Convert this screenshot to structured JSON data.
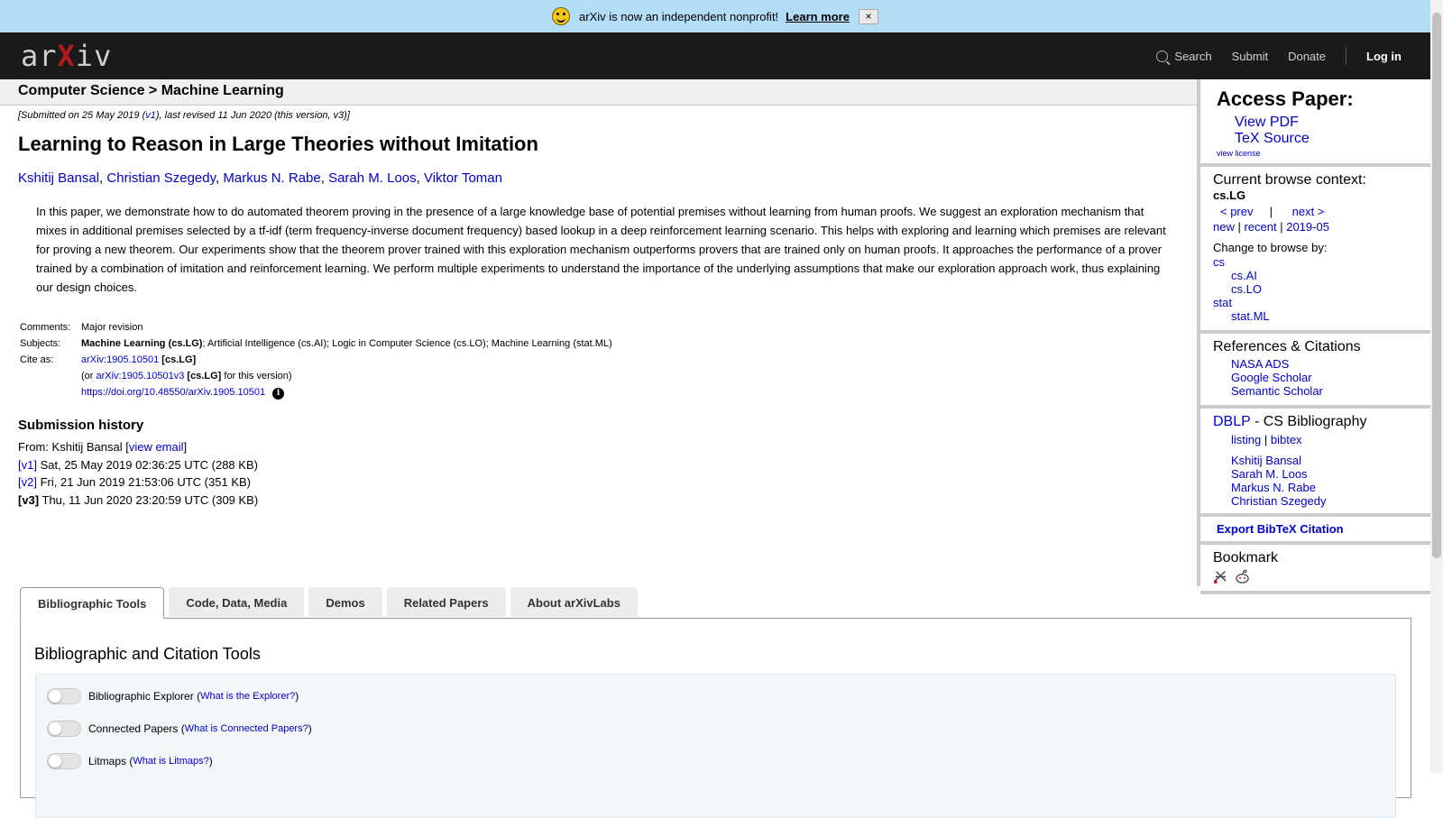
{
  "banner": {
    "text": "arXiv is now an independent nonprofit!",
    "link": "Learn more",
    "close": "×"
  },
  "nav": {
    "logo_a": "ar",
    "logo_x": "X",
    "logo_b": "iv",
    "search": "Search",
    "submit": "Submit",
    "donate": "Donate",
    "login": "Log in"
  },
  "breadcrumb": "Computer Science > Machine Learning",
  "paper": {
    "dateline_pre": "[Submitted on 25 May 2019 (",
    "dateline_v1": "v1",
    "dateline_post": "), last revised 11 Jun 2020 (this version, v3)]",
    "title": "Learning to Reason in Large Theories without Imitation",
    "authors": [
      "Kshitij Bansal",
      "Christian Szegedy",
      "Markus N. Rabe",
      "Sarah M. Loos",
      "Viktor Toman"
    ],
    "abstract": "In this paper, we demonstrate how to do automated theorem proving in the presence of a large knowledge base of potential premises without learning from human proofs. We suggest an exploration mechanism that mixes in additional premises selected by a tf-idf (term frequency-inverse document frequency) based lookup in a deep reinforcement learning scenario. This helps with exploring and learning which premises are relevant for proving a new theorem. Our experiments show that the theorem prover trained with this exploration mechanism outperforms provers that are trained only on human proofs. It approaches the performance of a prover trained by a combination of imitation and reinforcement learning. We perform multiple experiments to understand the importance of the underlying assumptions that make our exploration approach work, thus explaining our design choices."
  },
  "meta": {
    "comments_label": "Comments:",
    "comments": "Major revision",
    "subjects_label": "Subjects:",
    "subjects_primary": "Machine Learning (cs.LG)",
    "subjects_rest": "; Artificial Intelligence (cs.AI); Logic in Computer Science (cs.LO); Machine Learning (stat.ML)",
    "cite_label": "Cite as:",
    "cite_id": "arXiv:1905.10501",
    "cite_cat": "[cs.LG]",
    "or_pre": "(or ",
    "cite_v": "arXiv:1905.10501v3",
    "or_post": " for this version)",
    "doi": "https://doi.org/10.48550/arXiv.1905.10501",
    "info": "i"
  },
  "history": {
    "heading": "Submission history",
    "from_pre": "From: Kshitij Bansal [",
    "view_email": "view email",
    "from_post": "]",
    "versions": [
      {
        "v": "[v1]",
        "text": " Sat, 25 May 2019 02:36:25 UTC (288 KB)"
      },
      {
        "v": "[v2]",
        "text": " Fri, 21 Jun 2019 21:53:06 UTC (351 KB)"
      },
      {
        "v": "[v3]",
        "text": " Thu, 11 Jun 2020 23:20:59 UTC (309 KB)"
      }
    ]
  },
  "sidebar": {
    "access_h": "Access Paper:",
    "view_pdf": "View PDF",
    "tex": "TeX Source",
    "license": "view license",
    "context_h": "Current browse context:",
    "context": "cs.LG",
    "prev": "< prev",
    "bar": "|",
    "next": "next >",
    "new": "new",
    "recent": "recent",
    "month": "2019-05",
    "change": "Change to browse by:",
    "cs": "cs",
    "cs_ai": "cs.AI",
    "cs_lo": "cs.LO",
    "stat": "stat",
    "stat_ml": "stat.ML",
    "refs_h": "References & Citations",
    "nasa": "NASA ADS",
    "google": "Google Scholar",
    "semantic": "Semantic Scholar",
    "dblp": "DBLP",
    "dblp_rest": " - CS Bibliography",
    "listing": "listing",
    "bibtex": "bibtex",
    "dblp_authors": [
      "Kshitij Bansal",
      "Sarah M. Loos",
      "Markus N. Rabe",
      "Christian Szegedy"
    ],
    "export": "Export BibTeX Citation",
    "bookmark_h": "Bookmark"
  },
  "tabs": [
    "Bibliographic Tools",
    "Code, Data, Media",
    "Demos",
    "Related Papers",
    "About arXivLabs"
  ],
  "tools": {
    "heading": "Bibliographic and Citation Tools",
    "rows": [
      {
        "label": "Bibliographic Explorer",
        "q": "What is the Explorer?"
      },
      {
        "label": "Connected Papers",
        "q": "What is Connected Papers?"
      },
      {
        "label": "Litmaps",
        "q": "What is Litmaps?"
      }
    ]
  }
}
